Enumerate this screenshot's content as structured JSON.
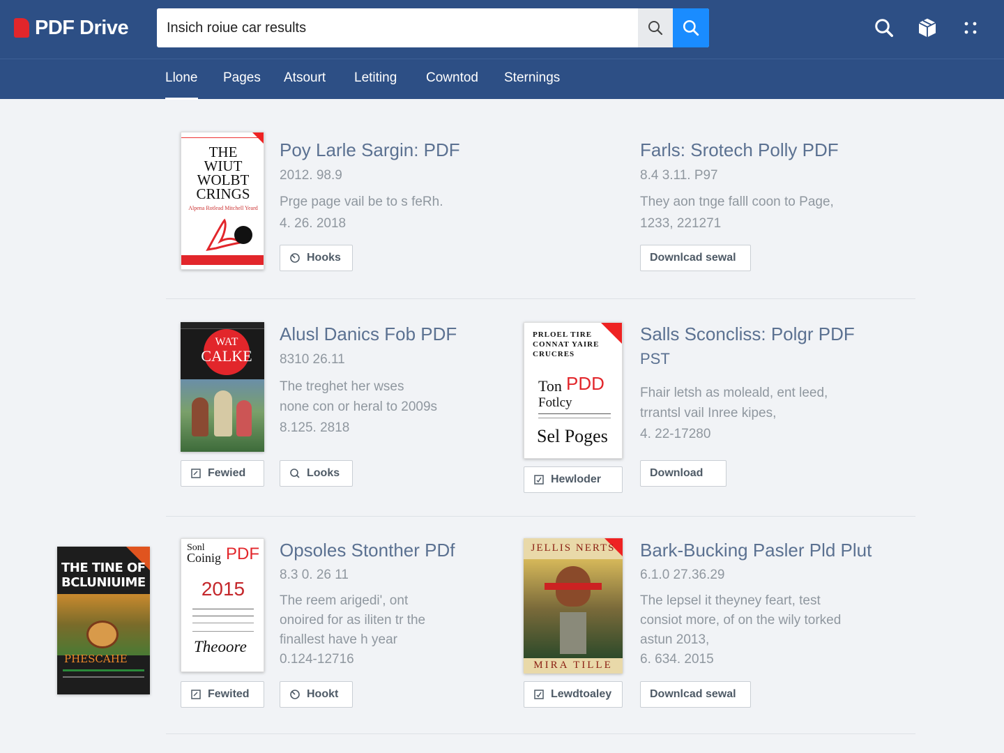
{
  "header": {
    "logo_text": "PDF Drive",
    "search_value": "Insich roiue car results",
    "search_placeholder": "Search"
  },
  "nav": [
    {
      "label": "Llone",
      "active": true
    },
    {
      "label": "Pages"
    },
    {
      "label": "Atsourt"
    },
    {
      "label": "Letiting"
    },
    {
      "label": "Cowntod"
    },
    {
      "label": "Sternings"
    }
  ],
  "results": [
    {
      "title": "Poy Larle Sargin: PDF",
      "line1": "2012. 98.9",
      "line2": "Prge page vail be to s feRh.",
      "line3": "4. 26. 2018",
      "button": "Hooks",
      "cover": {
        "lines": [
          "THE",
          "WIUT",
          "WOLBT",
          "CRINGS"
        ],
        "sub": "Alpena Rotlead Mitchell Yeard"
      }
    },
    {
      "title": "Farls: Srotech Polly PDF",
      "line1": "8.4 3.11. P97",
      "line2": "They aon tnge falll coon to Page,",
      "line3": "1233, 221271",
      "button": "Downlcad sewal"
    },
    {
      "title": "Alusl Danics Fob PDF",
      "line1": "8310 26.11",
      "line2": "The treghet her wses",
      "line3": "none con or heral to 2009s",
      "line4": "8.125. 2818",
      "button": "Looks",
      "button_left": "Fewied",
      "cover": {
        "badge_top": "WAT",
        "badge_main": "CALKE"
      }
    },
    {
      "title": "Salls Sconcliss: Polgr PDF",
      "title2": "PST",
      "line1": "Fhair letsh as moleald, ent leed,",
      "line2": "trrantsl vail Inree kipes,",
      "line3": "4. 22-17280",
      "button": "Download",
      "button_left": "Hewloder",
      "cover": {
        "lines": [
          "PRLOEL TIRE",
          "CONNAT YAIRE",
          "CRUCRES"
        ],
        "big1": "Ton",
        "big1b": "PDD",
        "big2": "Fotlcy",
        "big3": "Sel Poges"
      }
    },
    {
      "title": "Opsoles Stonther PDf",
      "line1": "8.3 0. 26 11",
      "line2": "The reem arigedi', ont",
      "line3": "onoired for as iliten tr the",
      "line4": "finallest have h year",
      "line5": "0.124-12716",
      "button": "Hookt",
      "button_left": "Fewited",
      "cover": {
        "top1": "Sonl",
        "top2": "Coinig",
        "pdf": "PDF",
        "year": "2015",
        "tag": "Theoore"
      }
    },
    {
      "title": "Bark-Bucking Pasler Pld Plut",
      "line1": "6.1.0 27.36.29",
      "line2": "The lepsel it theyney feart, test",
      "line3": "consiot more, of on the wily torked",
      "line4": "astun 2013,",
      "line5": "6. 634. 2015",
      "button": "Downlcad sewal",
      "button_left": "Lewdtoaley",
      "cover": {
        "top": "JELLIS NERTS",
        "bottom": "MIRA TILLE"
      }
    }
  ],
  "side_book": {
    "title1": "THE TINE OF",
    "title2": "BCLUNIUIME",
    "band": "PHESCAHE"
  }
}
